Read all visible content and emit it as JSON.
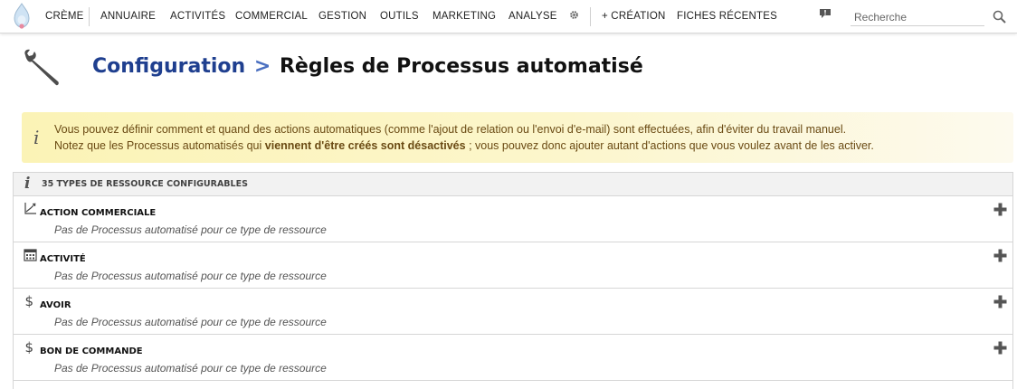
{
  "nav": {
    "items": [
      {
        "label": "Crème"
      },
      {
        "label": "Annuaire"
      },
      {
        "label": "Activités"
      },
      {
        "label": "Commercial"
      },
      {
        "label": "Gestion"
      },
      {
        "label": "Outils"
      },
      {
        "label": "Marketing"
      },
      {
        "label": "Analyse"
      },
      {
        "label": "+ Création"
      },
      {
        "label": "Fiches récentes"
      }
    ],
    "search_placeholder": "Recherche",
    "gear_icon": "gear-icon",
    "notification_icon": "speech-alert-icon",
    "search_icon": "magnifier-icon"
  },
  "page": {
    "breadcrumb": "Configuration",
    "separator": ">",
    "title": "Règles de Processus automatisé",
    "icon": "wrench-icon"
  },
  "banner": {
    "icon": "info-icon",
    "line1": "Vous pouvez définir comment et quand des actions automatiques (comme l'ajout de relation ou l'envoi d'e-mail) sont effectuées, afin d'éviter du travail manuel.",
    "line2_before": "Notez que les Processus automatisés qui ",
    "line2_bold": "viennent d'être créés sont désactivés",
    "line2_after": " ; vous pouvez donc ajouter autant d'actions que vous voulez avant de les activer."
  },
  "panel": {
    "header": "35 Types de ressource configurables",
    "rows": [
      {
        "title": "Action commerciale",
        "desc": "Pas de Processus automatisé pour ce type de ressource",
        "icon": "chart-trend-icon"
      },
      {
        "title": "Activité",
        "desc": "Pas de Processus automatisé pour ce type de ressource",
        "icon": "calendar-icon"
      },
      {
        "title": "Avoir",
        "desc": "Pas de Processus automatisé pour ce type de ressource",
        "icon": "dollar-icon"
      },
      {
        "title": "Bon de commande",
        "desc": "Pas de Processus automatisé pour ce type de ressource",
        "icon": "dollar-icon"
      }
    ]
  },
  "colors": {
    "breadcrumb": "#1f3f8f",
    "banner_bg": "#fbf3b6",
    "banner_text": "#6a4a13"
  }
}
